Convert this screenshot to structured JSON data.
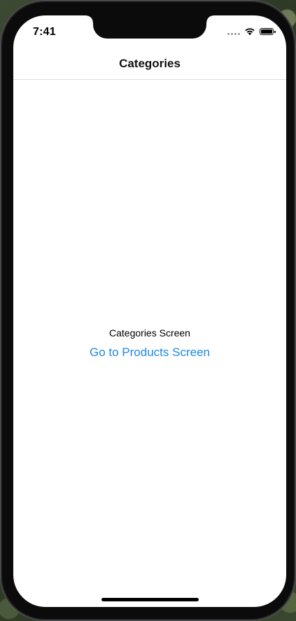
{
  "status_bar": {
    "time": "7:41",
    "icons": [
      "cellular-signal-icon",
      "wifi-icon",
      "battery-icon"
    ],
    "battery_level_percent": 100
  },
  "nav_bar": {
    "title": "Categories"
  },
  "main": {
    "screen_label": "Categories Screen",
    "link_label": "Go to Products Screen"
  },
  "colors": {
    "link": "#1e88e5",
    "background": "#ffffff",
    "separator": "#dcdcdc"
  }
}
